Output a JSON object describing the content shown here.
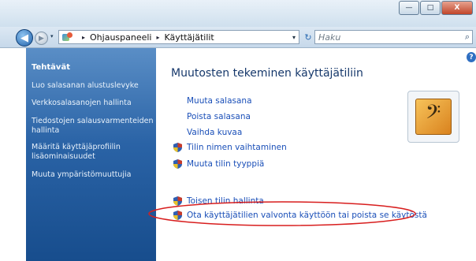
{
  "window": {
    "minimize_glyph": "—",
    "maximize_glyph": "□",
    "close_glyph": "X"
  },
  "navigation": {
    "back_glyph": "◀",
    "forward_glyph": "▶",
    "breadcrumb": [
      "Ohjauspaneeli",
      "Käyttäjätilit"
    ],
    "separator": "▸",
    "dropdown_glyph": "▾",
    "refresh_glyph": "↻",
    "search_placeholder": "Haku",
    "search_icon": "⌕"
  },
  "sidebar": {
    "title": "Tehtävät",
    "links": [
      "Luo salasanan alustuslevyke",
      "Verkkosalasanojen hallinta",
      "Tiedostojen salausvarmenteiden hallinta",
      "Määritä käyttäjäprofiilin lisäominaisuudet",
      "Muuta ympäristömuuttujia"
    ]
  },
  "main": {
    "heading": "Muutosten tekeminen käyttäjätiliin",
    "help_glyph": "?",
    "links": [
      "Muuta salasana",
      "Poista salasana",
      "Vaihda kuvaa",
      "Tilin nimen vaihtaminen",
      "Muuta tilin tyyppiä"
    ],
    "secondary_links": [
      "Toisen tilin hallinta",
      "Ota käyttäjätilien valvonta käyttöön tai poista se käytöstä"
    ],
    "user_picture_glyph": "𝄢"
  },
  "colors": {
    "sidebar_top": "#5a8ec6",
    "sidebar_bottom": "#174d8d",
    "link": "#1a4fb8",
    "heading": "#16386b",
    "highlight_ellipse": "#d81e1e"
  }
}
